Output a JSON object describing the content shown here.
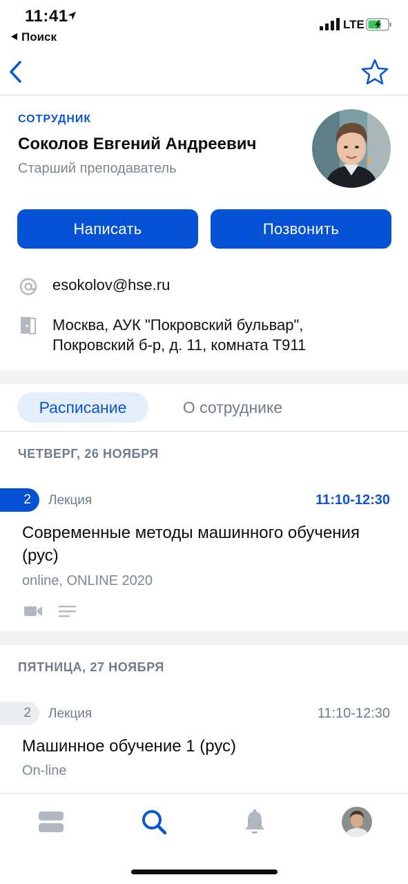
{
  "status_bar": {
    "time": "11:41",
    "back_app": "Поиск",
    "network": "LTE"
  },
  "profile": {
    "role": "СОТРУДНИК",
    "name": "Соколов Евгений Андреевич",
    "position": "Старший преподаватель"
  },
  "actions": {
    "write_label": "Написать",
    "call_label": "Позвонить"
  },
  "contacts": {
    "email": "esokolov@hse.ru",
    "address_line1": "Москва, АУК \"Покровский бульвар\",",
    "address_line2": "Покровский б-р, д. 11, комната Т911"
  },
  "tabs": {
    "schedule": "Расписание",
    "about": "О сотруднике",
    "active": "schedule"
  },
  "schedule": [
    {
      "day": "ЧЕТВЕРГ, 26 НОЯБРЯ",
      "lessons": [
        {
          "pair": "2",
          "type": "Лекция",
          "time": "11:10-12:30",
          "title_line1": "Современные методы машинного обучения",
          "title_line2": "(рус)",
          "place": "online, ONLINE 2020",
          "active": true
        }
      ]
    },
    {
      "day": "ПЯТНИЦА, 27 НОЯБРЯ",
      "lessons": [
        {
          "pair": "2",
          "type": "Лекция",
          "time": "11:10-12:30",
          "title_line1": "Машинное обучение 1 (рус)",
          "place": "On-line",
          "active": false
        }
      ]
    }
  ],
  "colors": {
    "accent": "#0652d6",
    "muted": "#717b8d",
    "tab_bg": "#e4edfa",
    "band": "#f1f2f4"
  },
  "icons": {
    "nav": [
      "back-chevron-icon",
      "star-icon"
    ],
    "contacts": [
      "at-sign-icon",
      "door-icon"
    ],
    "lesson": [
      "video-camera-icon",
      "notes-icon"
    ],
    "tabbar": [
      "feed-icon",
      "search-icon",
      "bell-icon",
      "profile-avatar"
    ]
  }
}
